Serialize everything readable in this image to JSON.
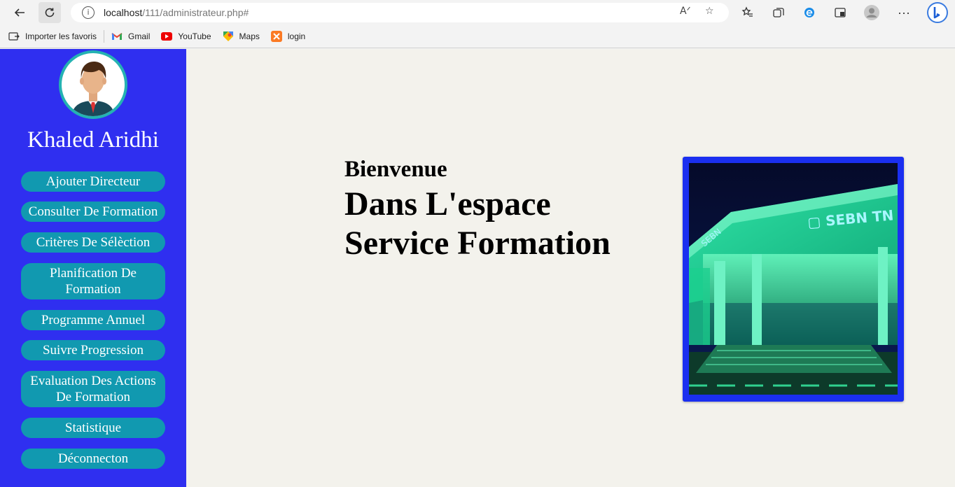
{
  "browser": {
    "url_host": "localhost",
    "url_path": "/111/administrateur.php#",
    "bookmarks": [
      "Importer les favoris",
      "Gmail",
      "YouTube",
      "Maps",
      "login"
    ]
  },
  "sidebar": {
    "user_name": "Khaled Aridhi",
    "menu": [
      "Ajouter Directeur",
      "Consulter De Formation",
      "Critères De Sélèction",
      "Planification De Formation",
      "Programme Annuel",
      "Suivre Progression",
      "Evaluation Des Actions De Formation",
      "Statistique",
      "Déconnecton"
    ]
  },
  "main": {
    "welcome_line1": "Bienvenue",
    "welcome_line2": "Dans L'espace",
    "welcome_line3": "Service Formation",
    "photo_sign": "SEBN TN"
  },
  "colors": {
    "sidebar_bg": "#2f2ff0",
    "menu_button": "#1199b0",
    "page_bg": "#f3f2ec",
    "photo_frame": "#1a2ff0"
  }
}
